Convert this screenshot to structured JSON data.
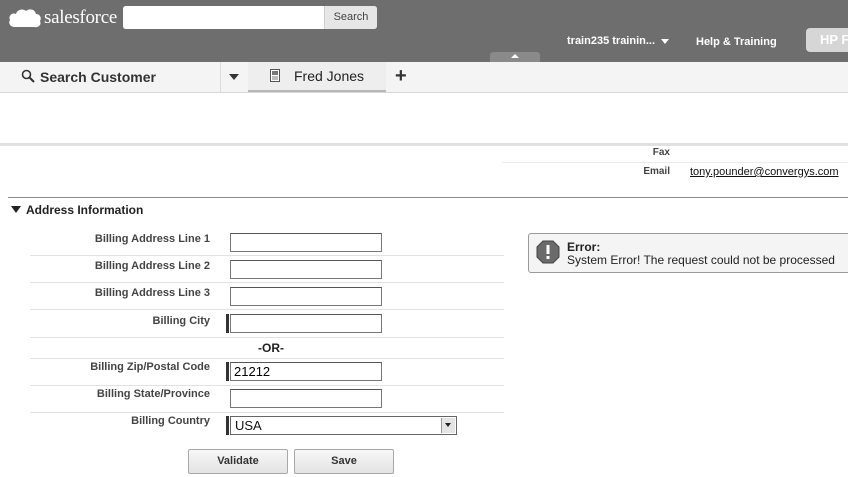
{
  "header": {
    "logo_text": "salesforce",
    "search_placeholder": "",
    "search_button": "Search",
    "user_menu": "train235 trainin...",
    "help_link": "Help & Training",
    "app_button": "HP F"
  },
  "tabs": {
    "search_tab": "Search Customer",
    "active_tab": "Fred Jones",
    "add_tab": "+"
  },
  "contact_info": [
    {
      "label": "Fax",
      "value": ""
    },
    {
      "label": "Email",
      "value": "tony.pounder@convergys.com"
    }
  ],
  "section": {
    "title": "Address Information",
    "fields": [
      {
        "label": "Billing Address Line 1",
        "value": "",
        "required": false
      },
      {
        "label": "Billing Address Line 2",
        "value": "",
        "required": false
      },
      {
        "label": "Billing Address Line 3",
        "value": "",
        "required": false
      },
      {
        "label": "Billing City",
        "value": "",
        "required": true
      }
    ],
    "or_label": "-OR-",
    "fields2": [
      {
        "label": "Billing Zip/Postal Code",
        "value": "21212",
        "required": true
      },
      {
        "label": "Billing State/Province",
        "value": "",
        "required": false
      }
    ],
    "country": {
      "label": "Billing Country",
      "value": "USA"
    },
    "validate_button": "Validate",
    "save_button": "Save"
  },
  "error": {
    "title": "Error:",
    "message": "System Error! The request could not be processed"
  }
}
